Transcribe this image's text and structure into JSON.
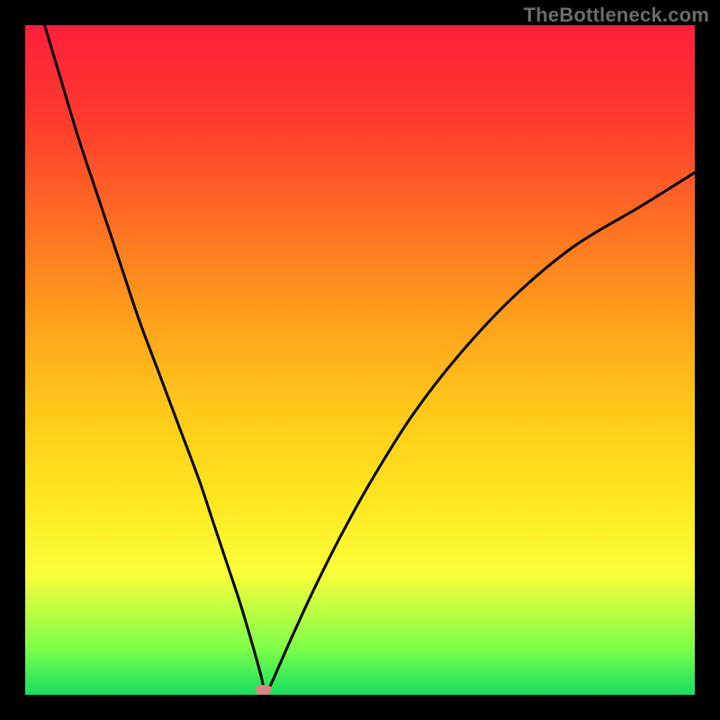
{
  "watermark": "TheBottleneck.com",
  "colors": {
    "frame": "#000000",
    "gradient_top": "#ff1f3a",
    "gradient_bottom": "#14e060",
    "curve": "#000000",
    "marker": "#d6877f",
    "watermark_text": "#6b6b6b"
  },
  "chart_data": {
    "type": "line",
    "title": "",
    "xlabel": "",
    "ylabel": "",
    "x_range": [
      0,
      100
    ],
    "y_range": [
      0,
      100
    ],
    "series": [
      {
        "name": "bottleneck-curve",
        "x": [
          0,
          2,
          5,
          8,
          11,
          14,
          17,
          20,
          23,
          26,
          28,
          30,
          32,
          33.5,
          34.5,
          35.3,
          35.6,
          36,
          36.5,
          37,
          38,
          40,
          43,
          47,
          52,
          58,
          65,
          73,
          82,
          92,
          100
        ],
        "y": [
          110,
          103,
          93,
          83,
          74,
          65,
          56,
          48,
          40,
          32,
          26,
          20,
          14,
          9,
          5.5,
          2.5,
          1.2,
          0.5,
          1.2,
          2.2,
          4.5,
          9,
          15.5,
          23.5,
          32.5,
          42,
          51,
          59.5,
          67,
          73,
          78
        ]
      }
    ],
    "marker": {
      "x": 35.6,
      "y": 0.8
    },
    "notes": "x is horizontal position as % of plot width (0=left, 100=right); y is curve height as % of plot height (0=bottom, 100=top). Values estimated from pixels — no axes or labels present in source image."
  }
}
